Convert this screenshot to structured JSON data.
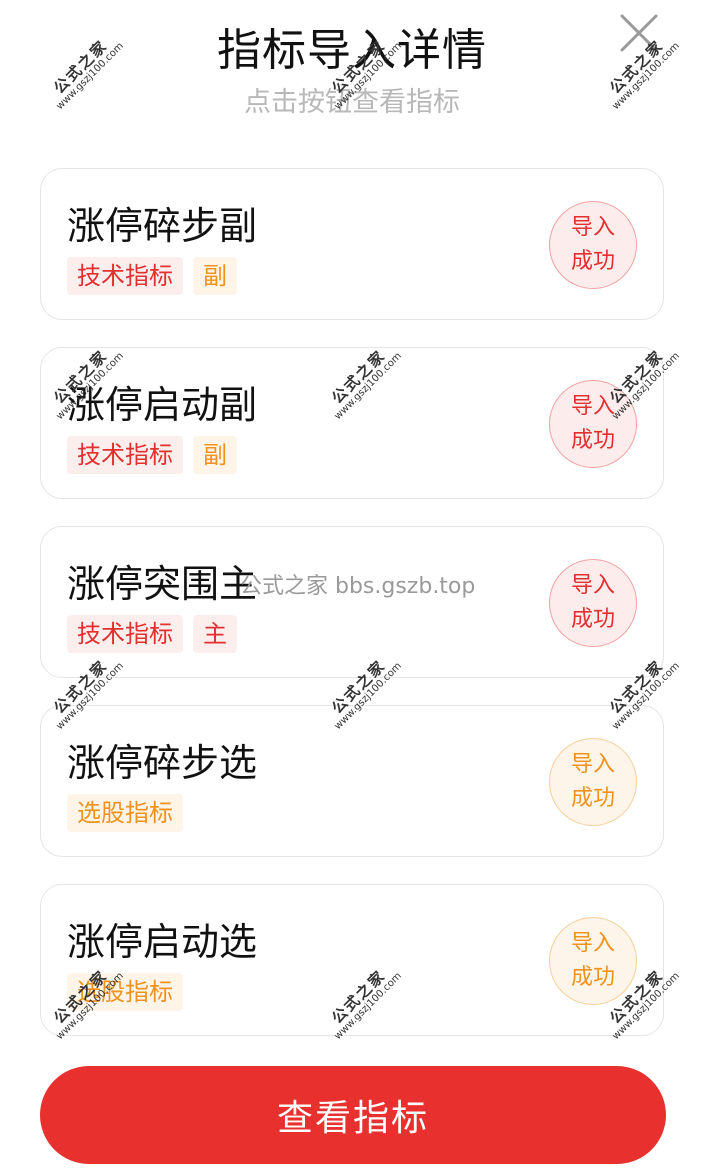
{
  "header": {
    "title": "指标导入详情",
    "subtitle": "点击按钮查看指标",
    "close_icon": "close-icon"
  },
  "indicators": [
    {
      "name": "涨停碎步副",
      "tags": [
        "技术指标",
        "副"
      ],
      "tag_colors": [
        "red",
        "orange"
      ],
      "status_line1": "导入",
      "status_line2": "成功",
      "status_color": "red"
    },
    {
      "name": "涨停启动副",
      "tags": [
        "技术指标",
        "副"
      ],
      "tag_colors": [
        "red",
        "orange"
      ],
      "status_line1": "导入",
      "status_line2": "成功",
      "status_color": "red"
    },
    {
      "name": "涨停突围主",
      "tags": [
        "技术指标",
        "主"
      ],
      "tag_colors": [
        "red",
        "red"
      ],
      "status_line1": "导入",
      "status_line2": "成功",
      "status_color": "red"
    },
    {
      "name": "涨停碎步选",
      "tags": [
        "选股指标"
      ],
      "tag_colors": [
        "orange"
      ],
      "status_line1": "导入",
      "status_line2": "成功",
      "status_color": "orange"
    },
    {
      "name": "涨停启动选",
      "tags": [
        "选股指标"
      ],
      "tag_colors": [
        "orange"
      ],
      "status_line1": "导入",
      "status_line2": "成功",
      "status_color": "orange"
    }
  ],
  "watermark": {
    "cn": "公式之家",
    "en": "www.gszj100.com",
    "center_text": "公式之家 bbs.gszb.top"
  },
  "bottom_button": {
    "label": "查看指标"
  },
  "colors": {
    "accent_red": "#e8302f",
    "tag_red": "#e2302f",
    "tag_orange": "#f0931e",
    "subtitle_gray": "#b8b8b8"
  }
}
